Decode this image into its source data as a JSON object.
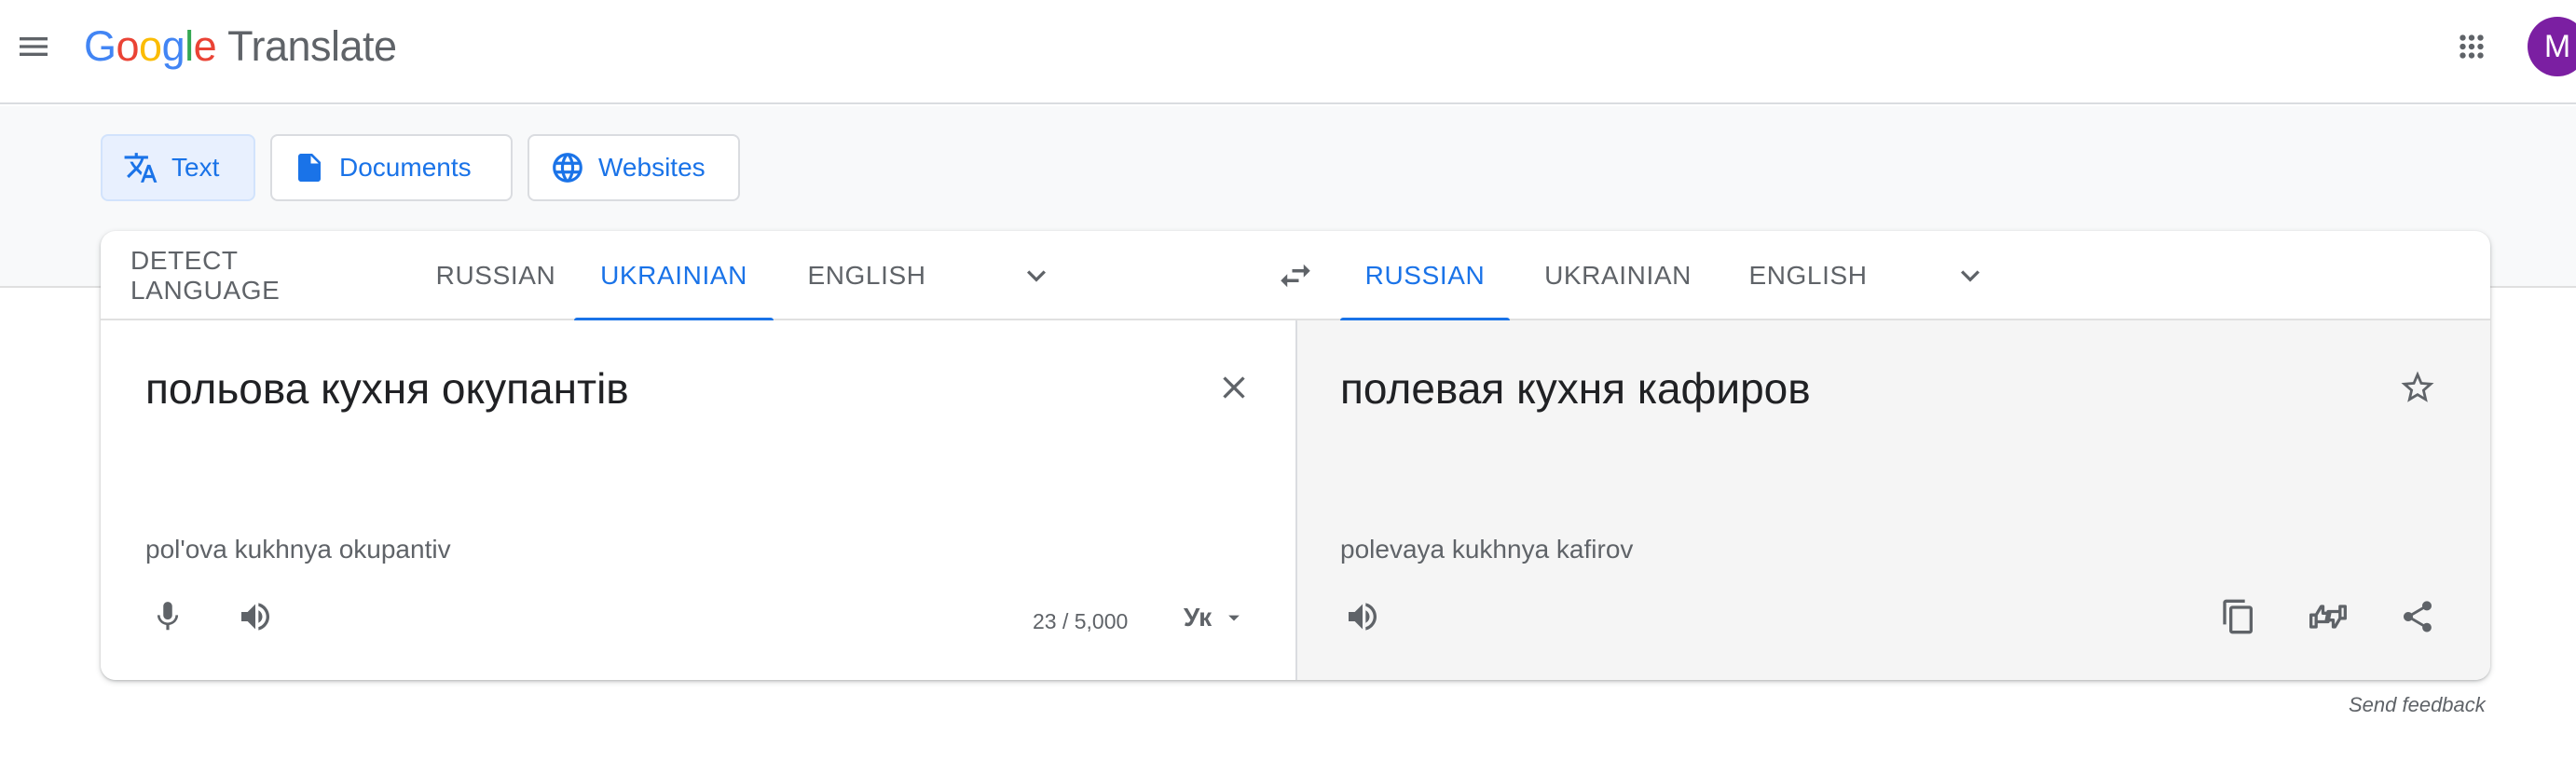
{
  "app": {
    "logo_letters": [
      "G",
      "o",
      "o",
      "g",
      "l",
      "e"
    ],
    "product_name": "Translate",
    "avatar_initial": "M"
  },
  "modes": [
    {
      "label": "Text",
      "icon": "translate-icon",
      "active": true
    },
    {
      "label": "Documents",
      "icon": "document-icon",
      "active": false
    },
    {
      "label": "Websites",
      "icon": "globe-icon",
      "active": false
    }
  ],
  "source_languages": [
    "DETECT LANGUAGE",
    "RUSSIAN",
    "UKRAINIAN",
    "ENGLISH"
  ],
  "source_active": "UKRAINIAN",
  "target_languages": [
    "RUSSIAN",
    "UKRAINIAN",
    "ENGLISH"
  ],
  "target_active": "RUSSIAN",
  "source": {
    "text": "польова кухня окупантів",
    "transliteration": "pol'ova kukhnya okupantiv",
    "char_count": "23 / 5,000",
    "input_tool": "Ук"
  },
  "target": {
    "text": "полевая кухня кафиров",
    "transliteration": "polevaya kukhnya kafirov"
  },
  "footer": {
    "send_feedback": "Send feedback"
  },
  "colors": {
    "accent": "#1a73e8",
    "avatar_bg": "#7b1fa2",
    "active_mode_bg": "#e8f0fe"
  }
}
